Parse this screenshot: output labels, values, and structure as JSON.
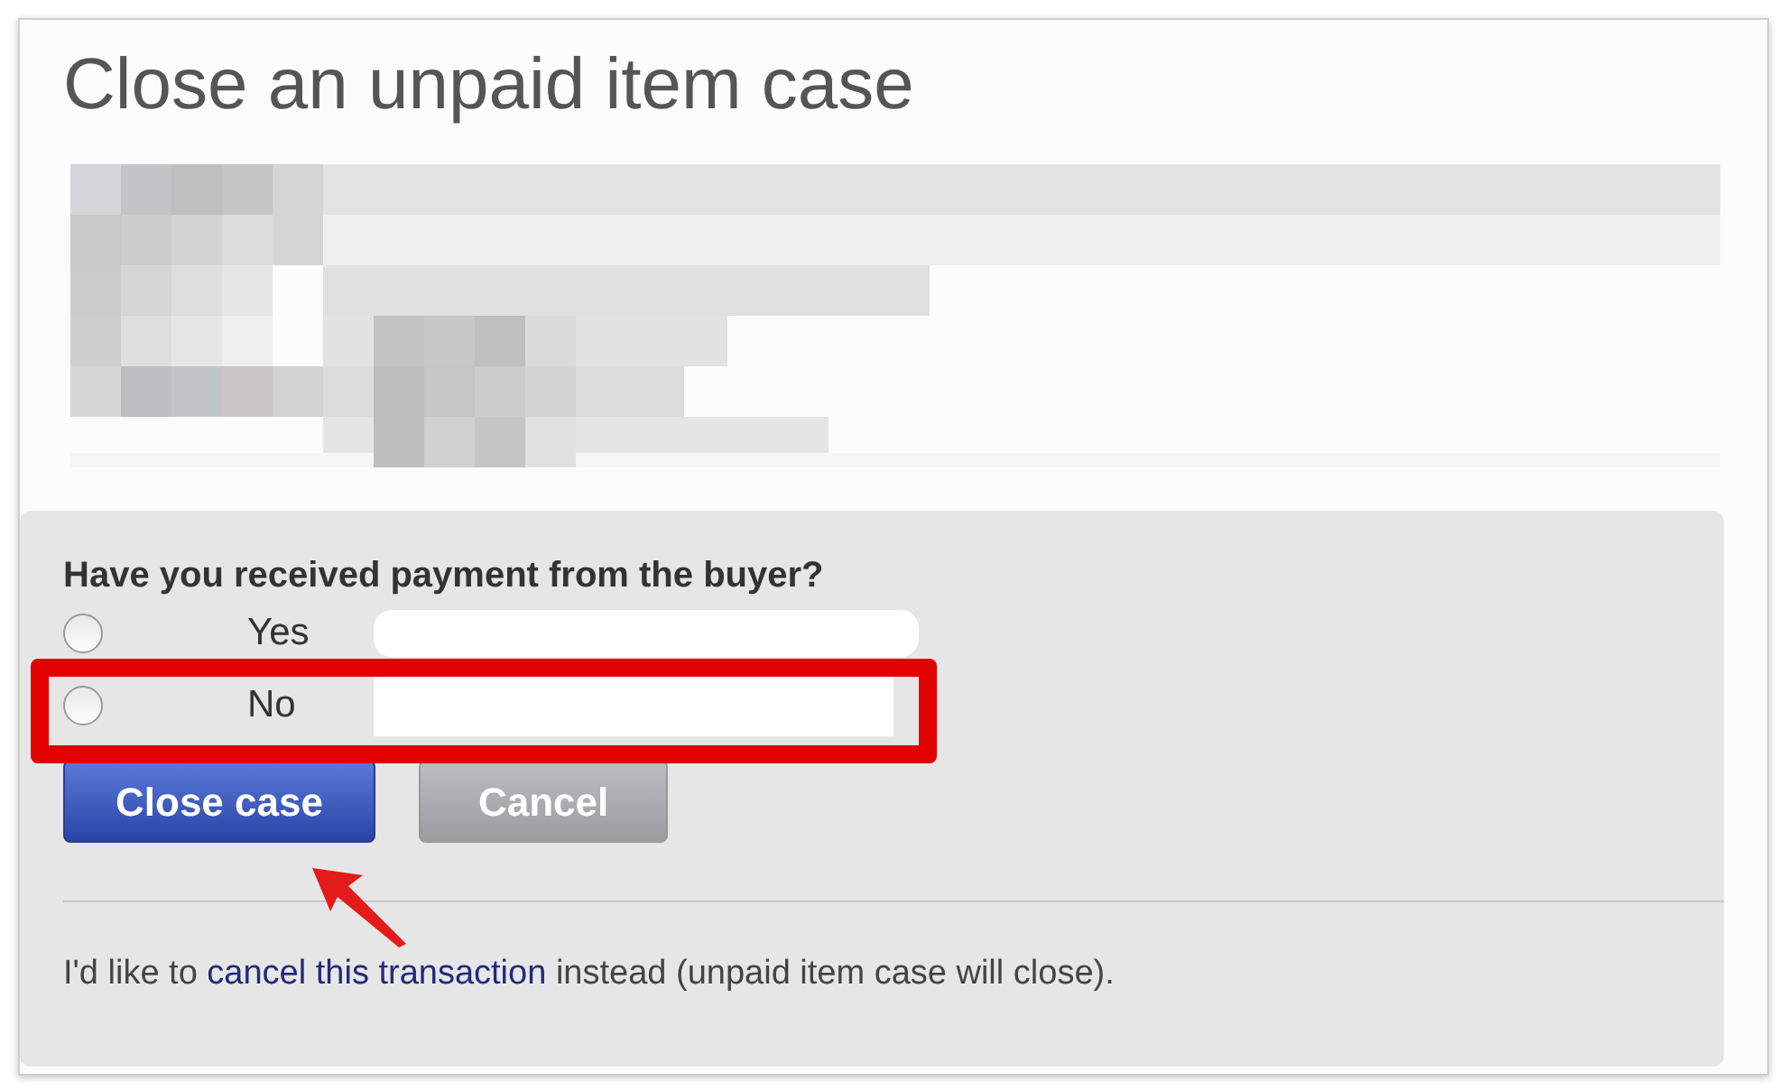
{
  "title": "Close an unpaid item case",
  "question": "Have you received payment from the buyer?",
  "options": [
    {
      "label": "Yes",
      "selected": false
    },
    {
      "label": "No",
      "selected": false,
      "highlighted": true
    }
  ],
  "buttons": [
    {
      "label": "Close case",
      "kind": "primary"
    },
    {
      "label": "Cancel",
      "kind": "secondary"
    }
  ],
  "footer": {
    "before": "I'd like to ",
    "link": "cancel this transaction",
    "after": " instead (unpaid item case will close)."
  }
}
